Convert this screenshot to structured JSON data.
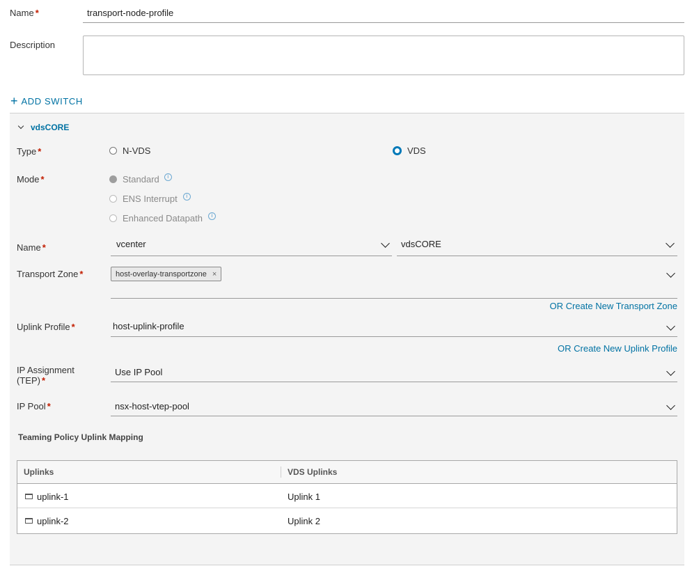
{
  "form": {
    "name_label": "Name",
    "name_value": "transport-node-profile",
    "description_label": "Description",
    "description_value": "",
    "add_switch_label": "ADD SWITCH"
  },
  "switch": {
    "title": "vdsCORE",
    "type_label": "Type",
    "type_options": [
      "N-VDS",
      "VDS"
    ],
    "type_selected": "VDS",
    "mode_label": "Mode",
    "mode_options": [
      "Standard",
      "ENS Interrupt",
      "Enhanced Datapath"
    ],
    "name_label": "Name",
    "vcenter_value": "vcenter",
    "vds_value": "vdsCORE",
    "transport_zone_label": "Transport Zone",
    "transport_zone_chip": "host-overlay-transportzone",
    "create_transport_zone_link": "OR Create New Transport Zone",
    "uplink_profile_label": "Uplink Profile",
    "uplink_profile_value": "host-uplink-profile",
    "create_uplink_profile_link": "OR Create New Uplink Profile",
    "ip_assignment_label_1": "IP Assignment",
    "ip_assignment_label_2": "(TEP)",
    "ip_assignment_value": "Use IP Pool",
    "ip_pool_label": "IP Pool",
    "ip_pool_value": "nsx-host-vtep-pool",
    "teaming_heading": "Teaming Policy Uplink Mapping"
  },
  "grid": {
    "columns": [
      "Uplinks",
      "VDS Uplinks"
    ],
    "rows": [
      {
        "uplink": "uplink-1",
        "vds_uplink": "Uplink 1"
      },
      {
        "uplink": "uplink-2",
        "vds_uplink": "Uplink 2"
      }
    ]
  },
  "colors": {
    "accent": "#0079b8",
    "link": "#0072a3",
    "required": "#c21d00"
  }
}
